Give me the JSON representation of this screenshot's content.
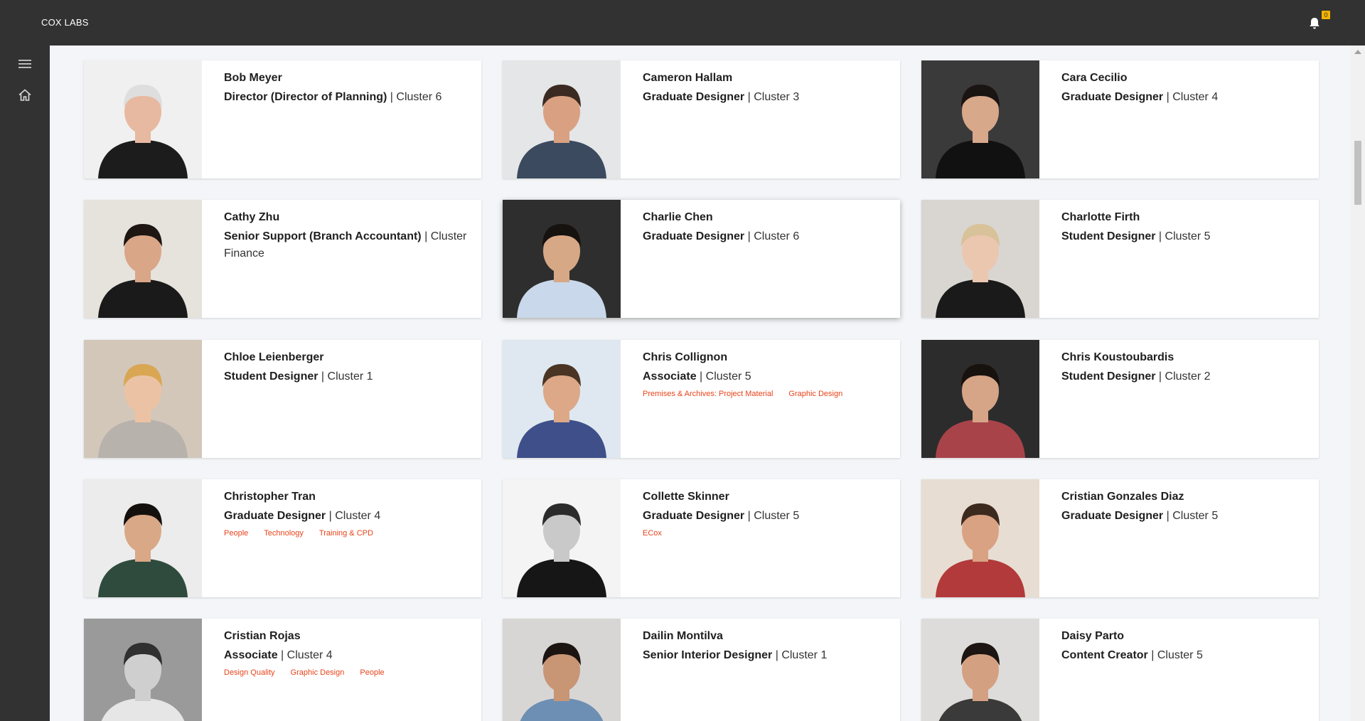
{
  "app": {
    "brand": "COX LABS",
    "notifications_count": "0"
  },
  "people": [
    {
      "name": "Bob Meyer",
      "title": "Director (Director of Planning)",
      "cluster": "Cluster 6",
      "tags": [],
      "bg": "#f0f0f0",
      "skin": "#e7b9a0",
      "hair": "#dedede",
      "shirt": "#1c1c1c",
      "bw": false
    },
    {
      "name": "Cameron Hallam",
      "title": "Graduate Designer",
      "cluster": "Cluster 3",
      "tags": [],
      "bg": "#e4e6e8",
      "skin": "#d9a182",
      "hair": "#3a2a22",
      "shirt": "#3b4a5e",
      "bw": false
    },
    {
      "name": "Cara Cecilio",
      "title": "Graduate Designer",
      "cluster": "Cluster 4",
      "tags": [],
      "bg": "#3a3a3a",
      "skin": "#d8a88a",
      "hair": "#1a1412",
      "shirt": "#111111",
      "bw": false
    },
    {
      "name": "Cathy Zhu",
      "title": "Senior Support (Branch Accountant)",
      "cluster": "Cluster Finance",
      "tags": [],
      "bg": "#e6e2dc",
      "skin": "#d9a688",
      "hair": "#1d1612",
      "shirt": "#1a1a1a",
      "bw": false
    },
    {
      "name": "Charlie Chen",
      "title": "Graduate Designer",
      "cluster": "Cluster 6",
      "tags": [],
      "bg": "#2e2e2e",
      "skin": "#d7a885",
      "hair": "#161210",
      "shirt": "#c9d8ea",
      "bw": false
    },
    {
      "name": "Charlotte Firth",
      "title": "Student Designer",
      "cluster": "Cluster 5",
      "tags": [],
      "bg": "#d9d6d2",
      "skin": "#ecc7b0",
      "hair": "#d8c29a",
      "shirt": "#1a1a1a",
      "bw": false
    },
    {
      "name": "Chloe Leienberger",
      "title": "Student Designer",
      "cluster": "Cluster 1",
      "tags": [],
      "bg": "#d2c7b9",
      "skin": "#ebc3a4",
      "hair": "#d9a654",
      "shirt": "#b8b2ac",
      "bw": false
    },
    {
      "name": "Chris Collignon",
      "title": "Associate",
      "cluster": "Cluster 5",
      "tags": [
        "Premises & Archives: Project Material",
        "Graphic Design"
      ],
      "bg": "#dfe8f0",
      "skin": "#dca888",
      "hair": "#4a3424",
      "shirt": "#3e4f8a",
      "bw": false
    },
    {
      "name": "Chris Koustoubardis",
      "title": "Student Designer",
      "cluster": "Cluster 2",
      "tags": [],
      "bg": "#2c2c2c",
      "skin": "#d6a487",
      "hair": "#18120f",
      "shirt": "#a8434a",
      "bw": false
    },
    {
      "name": "Christopher Tran",
      "title": "Graduate Designer",
      "cluster": "Cluster 4",
      "tags": [
        "People",
        "Technology",
        "Training & CPD"
      ],
      "bg": "#ececec",
      "skin": "#d9a886",
      "hair": "#14100e",
      "shirt": "#2f4b3e",
      "bw": false
    },
    {
      "name": "Collette Skinner",
      "title": "Graduate Designer",
      "cluster": "Cluster 5",
      "tags": [
        "ECox"
      ],
      "bg": "#f4f4f4",
      "skin": "#c9c9c9",
      "hair": "#2b2b2b",
      "shirt": "#161616",
      "bw": true
    },
    {
      "name": "Cristian Gonzales Diaz",
      "title": "Graduate Designer",
      "cluster": "Cluster 5",
      "tags": [],
      "bg": "#e8ddd3",
      "skin": "#d9a282",
      "hair": "#3c2a1f",
      "shirt": "#b23a3a",
      "bw": false
    },
    {
      "name": "Cristian Rojas",
      "title": "Associate",
      "cluster": "Cluster 4",
      "tags": [
        "Design Quality",
        "Graphic Design",
        "People"
      ],
      "bg": "#9a9a9a",
      "skin": "#cfcfcf",
      "hair": "#303030",
      "shirt": "#e6e6e6",
      "bw": true
    },
    {
      "name": "Dailin Montilva",
      "title": "Senior Interior Designer",
      "cluster": "Cluster 1",
      "tags": [],
      "bg": "#d8d6d4",
      "skin": "#c89575",
      "hair": "#1c1410",
      "shirt": "#6d8fb4",
      "bw": false
    },
    {
      "name": "Daisy Parto",
      "title": "Content Creator",
      "cluster": "Cluster 5",
      "tags": [],
      "bg": "#dedcda",
      "skin": "#d3a182",
      "hair": "#1c1512",
      "shirt": "#3a3a3a",
      "bw": false
    }
  ]
}
